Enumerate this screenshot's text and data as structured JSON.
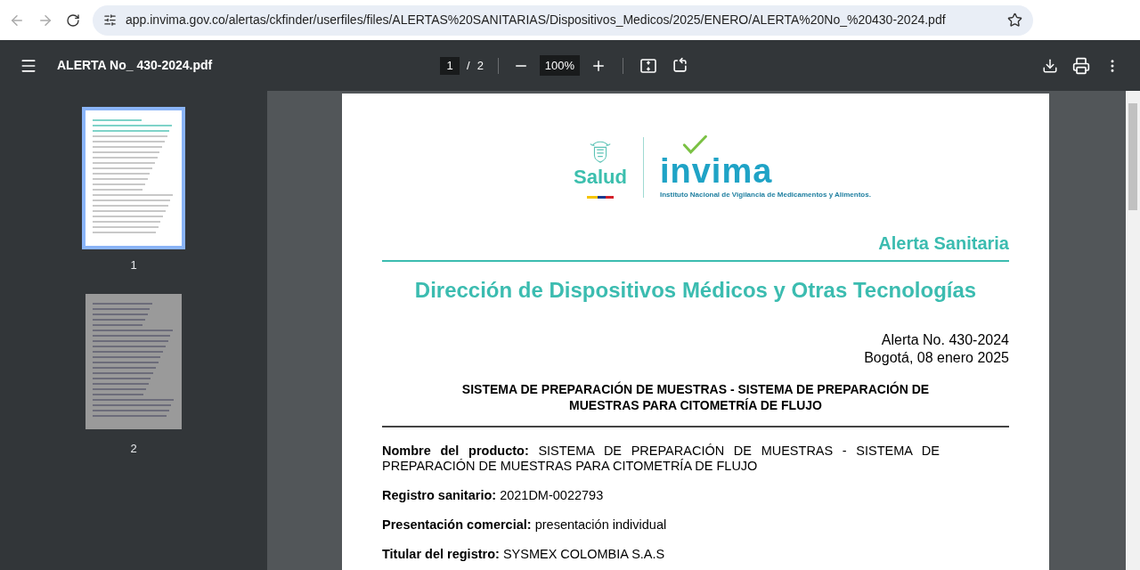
{
  "browser": {
    "address": "app.invima.gov.co/alertas/ckfinder/userfiles/files/ALERTAS%20SANITARIAS/Dispositivos_Medicos/2025/ENERO/ALERTA%20No_%20430-2024.pdf"
  },
  "toolbar": {
    "title": "ALERTA No_ 430-2024.pdf",
    "page_input": "1",
    "separator": "/",
    "page_total": "2",
    "zoom": "100%"
  },
  "sidebar": {
    "thumbnails": [
      {
        "label": "1",
        "selected": true
      },
      {
        "label": "2",
        "selected": false
      }
    ]
  },
  "document": {
    "logo": {
      "ministry": "Salud",
      "brand": "invima",
      "tagline": "Instituto Nacional de Vigilancia de Medicamentos y Alimentos."
    },
    "category": "Alerta Sanitaria",
    "heading": "Dirección de Dispositivos Médicos y Otras Tecnologías",
    "alert_number": "Alerta No. 430-2024",
    "date": "Bogotá, 08 enero 2025",
    "product_title": "SISTEMA DE PREPARACIÓN DE MUESTRAS - SISTEMA DE PREPARACIÓN DE MUESTRAS PARA CITOMETRÍA DE FLUJO",
    "fields": [
      {
        "label": "Nombre del producto:",
        "value": "SISTEMA DE PREPARACIÓN DE MUESTRAS - SISTEMA DE PREPARACIÓN DE MUESTRAS PARA CITOMETRÍA DE FLUJO"
      },
      {
        "label": "Registro sanitario:",
        "value": "2021DM-0022793"
      },
      {
        "label": "Presentación comercial:",
        "value": "presentación individual"
      },
      {
        "label": "Titular del registro:",
        "value": "SYSMEX COLOMBIA S.A.S"
      }
    ]
  }
}
